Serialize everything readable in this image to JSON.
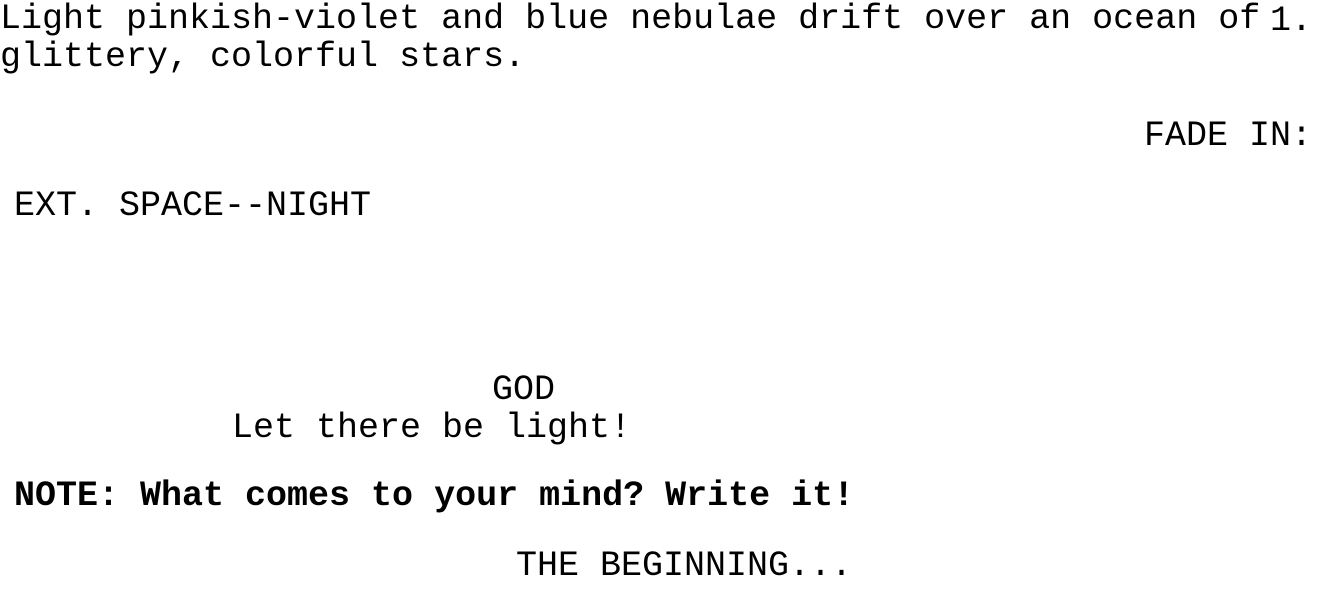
{
  "document": {
    "type": "screenplay",
    "page_number": "1.",
    "background_color": "#ffffff",
    "text_color": "#000000"
  },
  "elements": {
    "transition_in": "FADE IN:",
    "scene_heading": "EXT. SPACE--NIGHT",
    "action": {
      "line_1": "Light pinkish-violet and blue nebulae drift over an ocean of",
      "line_2": "glittery, colorful stars."
    },
    "character_cue": "GOD",
    "dialogue": "Let there be light!",
    "note": "NOTE: What comes to your mind? Write it!",
    "transition_end": "THE BEGINNING..."
  }
}
